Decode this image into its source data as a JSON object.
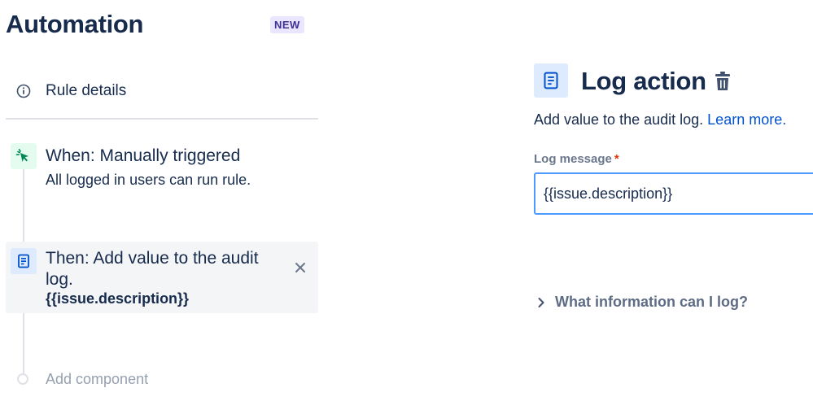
{
  "header": {
    "title": "Automation",
    "badge": "NEW"
  },
  "rule_details": {
    "label": "Rule details",
    "icon": "info-icon"
  },
  "components": [
    {
      "type": "trigger",
      "icon": "cursor-click-icon",
      "title": "When: Manually triggered",
      "subtitle": "All logged in users can run rule."
    },
    {
      "type": "action",
      "icon": "log-document-icon",
      "title": "Then: Add value to the audit log.",
      "value": "{{issue.description}}",
      "remove_icon": "close-icon"
    }
  ],
  "add_component": {
    "label": "Add component"
  },
  "panel": {
    "icon": "log-document-icon",
    "title": "Log action",
    "delete_icon": "trash-icon",
    "description": "Add value to the audit log.",
    "learn_more": "Learn more.",
    "field": {
      "label": "Log message",
      "required_marker": "*",
      "value": "{{issue.description}}"
    },
    "expander": {
      "label": "What information can I log?",
      "icon": "chevron-right-icon"
    }
  },
  "colors": {
    "text": "#172b4d",
    "link": "#0052cc",
    "badge_bg": "#eae6ff",
    "badge_text": "#403294",
    "trigger_bg": "#e3fcef",
    "trigger_icon": "#00875a",
    "action_bg": "#deebff",
    "action_icon": "#0052cc",
    "input_border": "#4c9aff",
    "required": "#de350b"
  }
}
